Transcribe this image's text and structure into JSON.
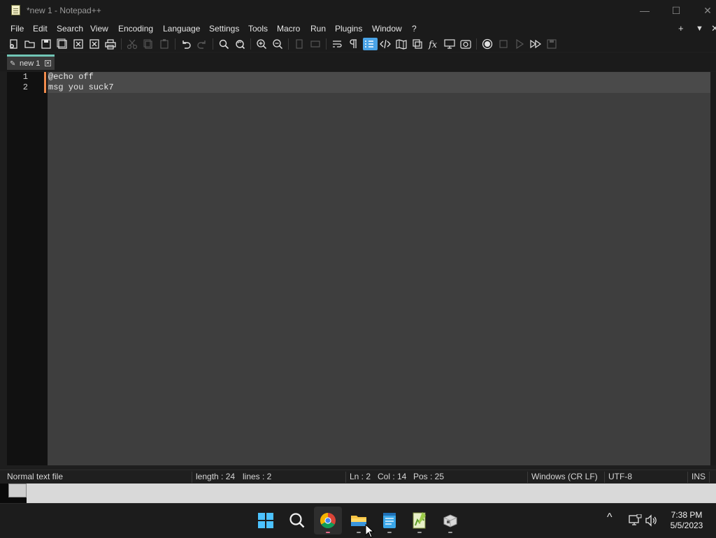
{
  "window": {
    "title": "*new 1 - Notepad++",
    "controls": {
      "minimize": "—",
      "maximize": "☐",
      "close": "✕"
    }
  },
  "menu": {
    "items": [
      "File",
      "Edit",
      "Search",
      "View",
      "Encoding",
      "Language",
      "Settings",
      "Tools",
      "Macro",
      "Run",
      "Plugins",
      "Window",
      "?"
    ],
    "right": {
      "add": "+",
      "dropdown": "▼",
      "close": "✕"
    }
  },
  "toolbar": {
    "icons": [
      "new-file-icon",
      "open-file-icon",
      "save-icon",
      "save-all-icon",
      "close-icon",
      "close-all-icon",
      "print-icon",
      "cut-icon",
      "copy-icon",
      "paste-icon",
      "undo-icon",
      "redo-icon",
      "find-icon",
      "replace-icon",
      "zoom-in-icon",
      "zoom-out-icon",
      "sync-vertical-icon",
      "sync-horizontal-icon",
      "word-wrap-icon",
      "show-all-chars-icon",
      "indent-guide-icon",
      "language-xml-icon",
      "document-map-icon",
      "clone-icon",
      "function-list-icon",
      "monitor-icon",
      "screenshot-icon",
      "record-macro-icon",
      "stop-macro-icon",
      "play-macro-icon",
      "run-macro-multiple-icon",
      "save-macro-icon"
    ],
    "accent": "#4aa3e6"
  },
  "tabs": [
    {
      "label": "new 1",
      "close": "✕",
      "modified": true
    }
  ],
  "editor": {
    "lines": [
      {
        "number": "1",
        "text": "@echo off"
      },
      {
        "number": "2",
        "text": "msg you suck7"
      }
    ],
    "change_marker_color": "#f08a4b"
  },
  "status": {
    "file_type": "Normal text file",
    "length": "length : 24",
    "lines": "lines : 2",
    "ln": "Ln : 2",
    "col": "Col : 14",
    "pos": "Pos : 25",
    "eol": "Windows (CR LF)",
    "encoding": "UTF-8",
    "mode": "INS"
  },
  "taskbar": {
    "apps": [
      "start-icon",
      "search-icon",
      "chrome-icon",
      "file-explorer-icon",
      "notepad-icon",
      "notepad-plus-plus-icon",
      "generic-app-icon"
    ],
    "tray": {
      "chevron": "^",
      "network": "network-icon",
      "volume": "volume-icon"
    },
    "clock": {
      "time": "7:38 PM",
      "date": "5/5/2023"
    }
  }
}
